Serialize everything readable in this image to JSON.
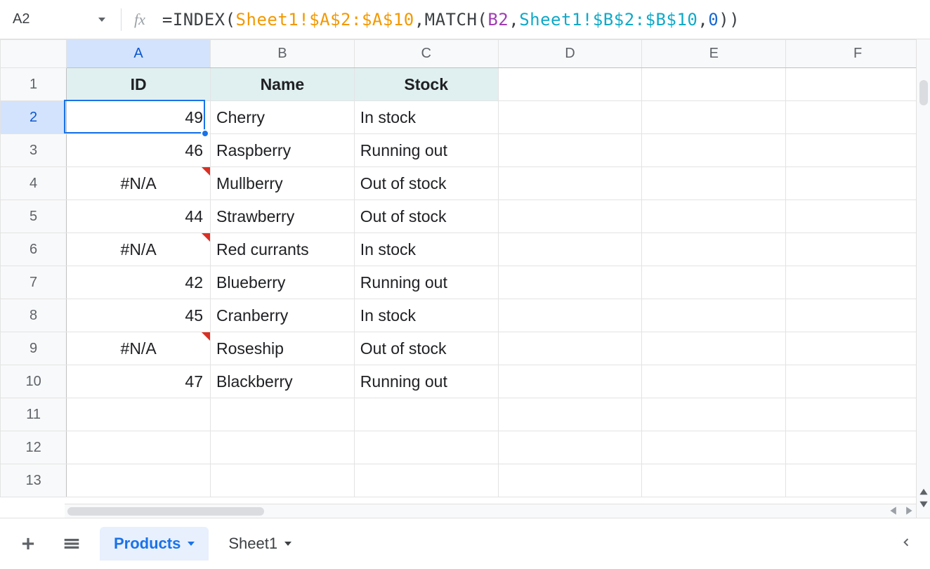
{
  "formula_bar": {
    "cell_ref": "A2",
    "formula_tokens": [
      {
        "t": "=",
        "c": "tok-eq"
      },
      {
        "t": "INDEX",
        "c": "tok-fn"
      },
      {
        "t": "(",
        "c": "tok-punc"
      },
      {
        "t": "Sheet1!$A$2:$A$10",
        "c": "tok-ref1"
      },
      {
        "t": ",",
        "c": "tok-punc"
      },
      {
        "t": "MATCH",
        "c": "tok-fn"
      },
      {
        "t": "(",
        "c": "tok-punc"
      },
      {
        "t": "B2",
        "c": "tok-ref2"
      },
      {
        "t": ",",
        "c": "tok-punc"
      },
      {
        "t": "Sheet1!$B$2:$B$10",
        "c": "tok-ref3"
      },
      {
        "t": ",",
        "c": "tok-punc"
      },
      {
        "t": "0",
        "c": "tok-num"
      },
      {
        "t": ")",
        "c": "tok-punc"
      },
      {
        "t": ")",
        "c": "tok-punc"
      }
    ]
  },
  "columns": [
    "A",
    "B",
    "C",
    "D",
    "E",
    "F"
  ],
  "headers": {
    "A": "ID",
    "B": "Name",
    "C": "Stock"
  },
  "rows": [
    {
      "n": 1,
      "A": "ID",
      "B": "Name",
      "C": "Stock",
      "hdr": true
    },
    {
      "n": 2,
      "A": "49",
      "B": "Cherry",
      "C": "In stock"
    },
    {
      "n": 3,
      "A": "46",
      "B": "Raspberry",
      "C": "Running out"
    },
    {
      "n": 4,
      "A": "#N/A",
      "B": "Mullberry",
      "C": "Out of stock",
      "err": true
    },
    {
      "n": 5,
      "A": "44",
      "B": "Strawberry",
      "C": "Out of stock"
    },
    {
      "n": 6,
      "A": "#N/A",
      "B": "Red currants",
      "C": "In stock",
      "err": true
    },
    {
      "n": 7,
      "A": "42",
      "B": "Blueberry",
      "C": "Running out"
    },
    {
      "n": 8,
      "A": "45",
      "B": "Cranberry",
      "C": "In stock"
    },
    {
      "n": 9,
      "A": "#N/A",
      "B": "Roseship",
      "C": "Out of stock",
      "err": true
    },
    {
      "n": 10,
      "A": "47",
      "B": "Blackberry",
      "C": "Running out"
    },
    {
      "n": 11,
      "A": "",
      "B": "",
      "C": ""
    },
    {
      "n": 12,
      "A": "",
      "B": "",
      "C": ""
    },
    {
      "n": 13,
      "A": "",
      "B": "",
      "C": ""
    }
  ],
  "selected_cell": {
    "row": 2,
    "col": "A"
  },
  "sheet_tabs": [
    {
      "label": "Products",
      "active": true
    },
    {
      "label": "Sheet1",
      "active": false
    }
  ]
}
